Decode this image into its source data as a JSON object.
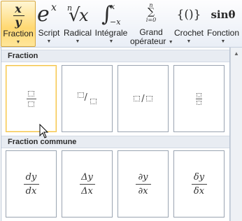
{
  "ribbon": {
    "buttons": [
      {
        "label": "Fraction",
        "has_caret": true,
        "icon": "fraction-icon",
        "num": "x",
        "den": "y"
      },
      {
        "label": "Script",
        "has_caret": true,
        "icon": "script-icon",
        "base": "e",
        "sup": "x"
      },
      {
        "label": "Radical",
        "has_caret": true,
        "icon": "radical-icon",
        "index": "n",
        "body": "x"
      },
      {
        "label": "Intégrale",
        "has_caret": true,
        "icon": "integral-icon",
        "upper": "x",
        "lower": "−x"
      },
      {
        "label_line1": "Grand",
        "label_line2": "opérateur",
        "has_caret": true,
        "icon": "large-operator-icon",
        "upper": "n",
        "lower": "i=0"
      },
      {
        "label": "Crochet",
        "has_caret": true,
        "icon": "bracket-icon",
        "glyph": "{()}"
      },
      {
        "label": "Fonction",
        "has_caret": true,
        "icon": "function-icon",
        "glyph": "sinθ"
      }
    ]
  },
  "gallery": {
    "sections": [
      {
        "title": "Fraction",
        "tiles": [
          "stacked-fraction",
          "skewed-fraction",
          "linear-fraction",
          "small-fraction"
        ]
      },
      {
        "title": "Fraction commune",
        "tiles": [
          {
            "num": "dy",
            "den": "dx"
          },
          {
            "num": "Δy",
            "den": "Δx"
          },
          {
            "num": "∂y",
            "den": "∂x"
          },
          {
            "num": "δy",
            "den": "δx"
          }
        ]
      }
    ]
  },
  "colors": {
    "selected_fill": "#ffd871",
    "selected_border": "#d7a73f",
    "section_header_bg": "#e8ecf2",
    "tile_border": "#9aa4b1"
  }
}
